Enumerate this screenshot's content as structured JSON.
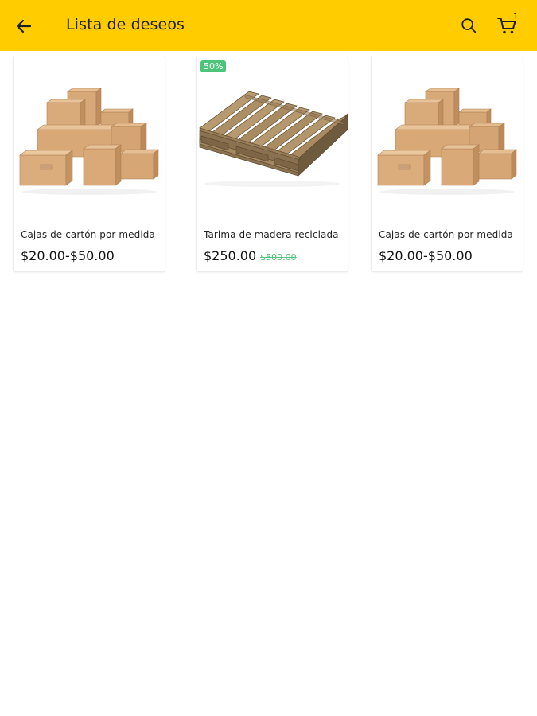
{
  "header": {
    "title": "Lista de deseos",
    "cart_count": "1",
    "background_color": "#FFCC00",
    "icons": [
      "back-arrow-icon",
      "search-icon",
      "cart-icon"
    ]
  },
  "products": [
    {
      "name": "Cajas de cartón por medida",
      "price": "$20.00-$50.00",
      "old_price": "",
      "badge": "",
      "image": "cardboard-boxes-image"
    },
    {
      "name": "Tarima de madera reciclada",
      "price": "$250.00",
      "old_price": "$500.00",
      "badge": "50%",
      "image": "wooden-pallet-image"
    },
    {
      "name": "Cajas de cartón por medida",
      "price": "$20.00-$50.00",
      "old_price": "",
      "badge": "",
      "image": "cardboard-boxes-image"
    }
  ],
  "colors": {
    "accent": "#FFCC00",
    "discount": "#4CC47A"
  }
}
